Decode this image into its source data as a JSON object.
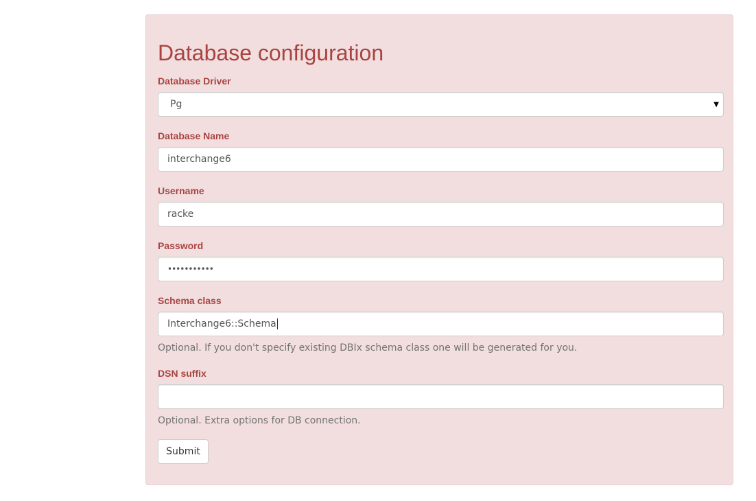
{
  "form": {
    "title": "Database configuration",
    "driver": {
      "label": "Database Driver",
      "value": "Pg"
    },
    "dbname": {
      "label": "Database Name",
      "value": "interchange6"
    },
    "username": {
      "label": "Username",
      "value": "racke"
    },
    "password": {
      "label": "Password",
      "value": "•••••••••••"
    },
    "schema": {
      "label": "Schema class",
      "value": "Interchange6::Schema",
      "help": "Optional. If you don't specify existing DBIx schema class one will be generated for you."
    },
    "dsn": {
      "label": "DSN suffix",
      "value": "",
      "help": "Optional. Extra options for DB connection."
    },
    "submit_label": "Submit"
  },
  "colors": {
    "panel_bg": "#f2dede",
    "panel_border": "#ebccd1",
    "label": "#a94442",
    "help_text": "#737373"
  }
}
